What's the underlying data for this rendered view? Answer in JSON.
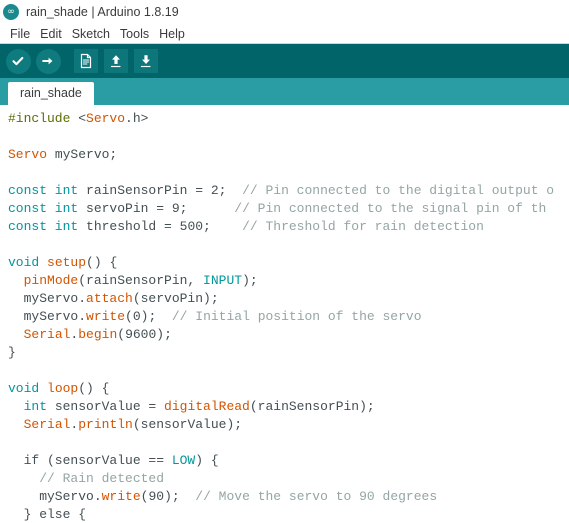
{
  "window": {
    "title": "rain_shade | Arduino 1.8.19",
    "logo_icon": "arduino-infinity-icon",
    "logo_glyph": "∞"
  },
  "menubar": {
    "items": [
      {
        "label": "File"
      },
      {
        "label": "Edit"
      },
      {
        "label": "Sketch"
      },
      {
        "label": "Tools"
      },
      {
        "label": "Help"
      }
    ]
  },
  "toolbar": {
    "buttons": [
      {
        "name": "verify-button",
        "icon": "check-icon",
        "glyph": "✔"
      },
      {
        "name": "upload-button",
        "icon": "arrow-right-icon",
        "glyph": "➜"
      },
      {
        "name": "new-button",
        "icon": "document-icon",
        "glyph": "☰"
      },
      {
        "name": "open-button",
        "icon": "arrow-up-icon",
        "glyph": "⬆"
      },
      {
        "name": "save-button",
        "icon": "arrow-down-icon",
        "glyph": "⬇"
      }
    ]
  },
  "tabs": [
    {
      "label": "rain_shade",
      "active": true
    }
  ],
  "editor": {
    "lines": [
      [
        {
          "t": "pre",
          "s": "#include "
        },
        {
          "t": "plain",
          "s": "<"
        },
        {
          "t": "type",
          "s": "Servo"
        },
        {
          "t": "plain",
          "s": ".h>"
        }
      ],
      [],
      [
        {
          "t": "type",
          "s": "Servo"
        },
        {
          "t": "plain",
          "s": " myServo;"
        }
      ],
      [],
      [
        {
          "t": "kw",
          "s": "const int"
        },
        {
          "t": "plain",
          "s": " rainSensorPin = "
        },
        {
          "t": "num",
          "s": "2"
        },
        {
          "t": "plain",
          "s": ";  "
        },
        {
          "t": "cmt",
          "s": "// Pin connected to the digital output o"
        }
      ],
      [
        {
          "t": "kw",
          "s": "const int"
        },
        {
          "t": "plain",
          "s": " servoPin = "
        },
        {
          "t": "num",
          "s": "9"
        },
        {
          "t": "plain",
          "s": ";      "
        },
        {
          "t": "cmt",
          "s": "// Pin connected to the signal pin of th"
        }
      ],
      [
        {
          "t": "kw",
          "s": "const int"
        },
        {
          "t": "plain",
          "s": " threshold = "
        },
        {
          "t": "num",
          "s": "500"
        },
        {
          "t": "plain",
          "s": ";    "
        },
        {
          "t": "cmt",
          "s": "// Threshold for rain detection"
        }
      ],
      [],
      [
        {
          "t": "kw",
          "s": "void"
        },
        {
          "t": "plain",
          "s": " "
        },
        {
          "t": "fn",
          "s": "setup"
        },
        {
          "t": "plain",
          "s": "() {"
        }
      ],
      [
        {
          "t": "plain",
          "s": "  "
        },
        {
          "t": "fn",
          "s": "pinMode"
        },
        {
          "t": "plain",
          "s": "(rainSensorPin, "
        },
        {
          "t": "const",
          "s": "INPUT"
        },
        {
          "t": "plain",
          "s": ");"
        }
      ],
      [
        {
          "t": "plain",
          "s": "  myServo."
        },
        {
          "t": "fn",
          "s": "attach"
        },
        {
          "t": "plain",
          "s": "(servoPin);"
        }
      ],
      [
        {
          "t": "plain",
          "s": "  myServo."
        },
        {
          "t": "fn",
          "s": "write"
        },
        {
          "t": "plain",
          "s": "("
        },
        {
          "t": "num",
          "s": "0"
        },
        {
          "t": "plain",
          "s": ");  "
        },
        {
          "t": "cmt",
          "s": "// Initial position of the servo"
        }
      ],
      [
        {
          "t": "plain",
          "s": "  "
        },
        {
          "t": "obj",
          "s": "Serial"
        },
        {
          "t": "plain",
          "s": "."
        },
        {
          "t": "fn",
          "s": "begin"
        },
        {
          "t": "plain",
          "s": "("
        },
        {
          "t": "num",
          "s": "9600"
        },
        {
          "t": "plain",
          "s": ");"
        }
      ],
      [
        {
          "t": "plain",
          "s": "}"
        }
      ],
      [],
      [
        {
          "t": "kw",
          "s": "void"
        },
        {
          "t": "plain",
          "s": " "
        },
        {
          "t": "fn",
          "s": "loop"
        },
        {
          "t": "plain",
          "s": "() {"
        }
      ],
      [
        {
          "t": "plain",
          "s": "  "
        },
        {
          "t": "kw",
          "s": "int"
        },
        {
          "t": "plain",
          "s": " sensorValue = "
        },
        {
          "t": "fn",
          "s": "digitalRead"
        },
        {
          "t": "plain",
          "s": "(rainSensorPin);"
        }
      ],
      [
        {
          "t": "plain",
          "s": "  "
        },
        {
          "t": "obj",
          "s": "Serial"
        },
        {
          "t": "plain",
          "s": "."
        },
        {
          "t": "fn",
          "s": "println"
        },
        {
          "t": "plain",
          "s": "(sensorValue);"
        }
      ],
      [],
      [
        {
          "t": "plain",
          "s": "  if (sensorValue == "
        },
        {
          "t": "const",
          "s": "LOW"
        },
        {
          "t": "plain",
          "s": ") {"
        }
      ],
      [
        {
          "t": "plain",
          "s": "    "
        },
        {
          "t": "cmt",
          "s": "// Rain detected"
        }
      ],
      [
        {
          "t": "plain",
          "s": "    myServo."
        },
        {
          "t": "fn",
          "s": "write"
        },
        {
          "t": "plain",
          "s": "("
        },
        {
          "t": "num",
          "s": "90"
        },
        {
          "t": "plain",
          "s": ");  "
        },
        {
          "t": "cmt",
          "s": "// Move the servo to 90 degrees"
        }
      ],
      [
        {
          "t": "plain",
          "s": "  } else {"
        }
      ]
    ]
  },
  "colors": {
    "toolbar_bg": "#006468",
    "tabstrip_bg": "#2a9da4",
    "accent_teal": "#00979c",
    "keyword": "#00979c",
    "function": "#d35400",
    "comment": "#95a5a6",
    "preprocessor": "#5e6d03",
    "text": "#434f54"
  }
}
